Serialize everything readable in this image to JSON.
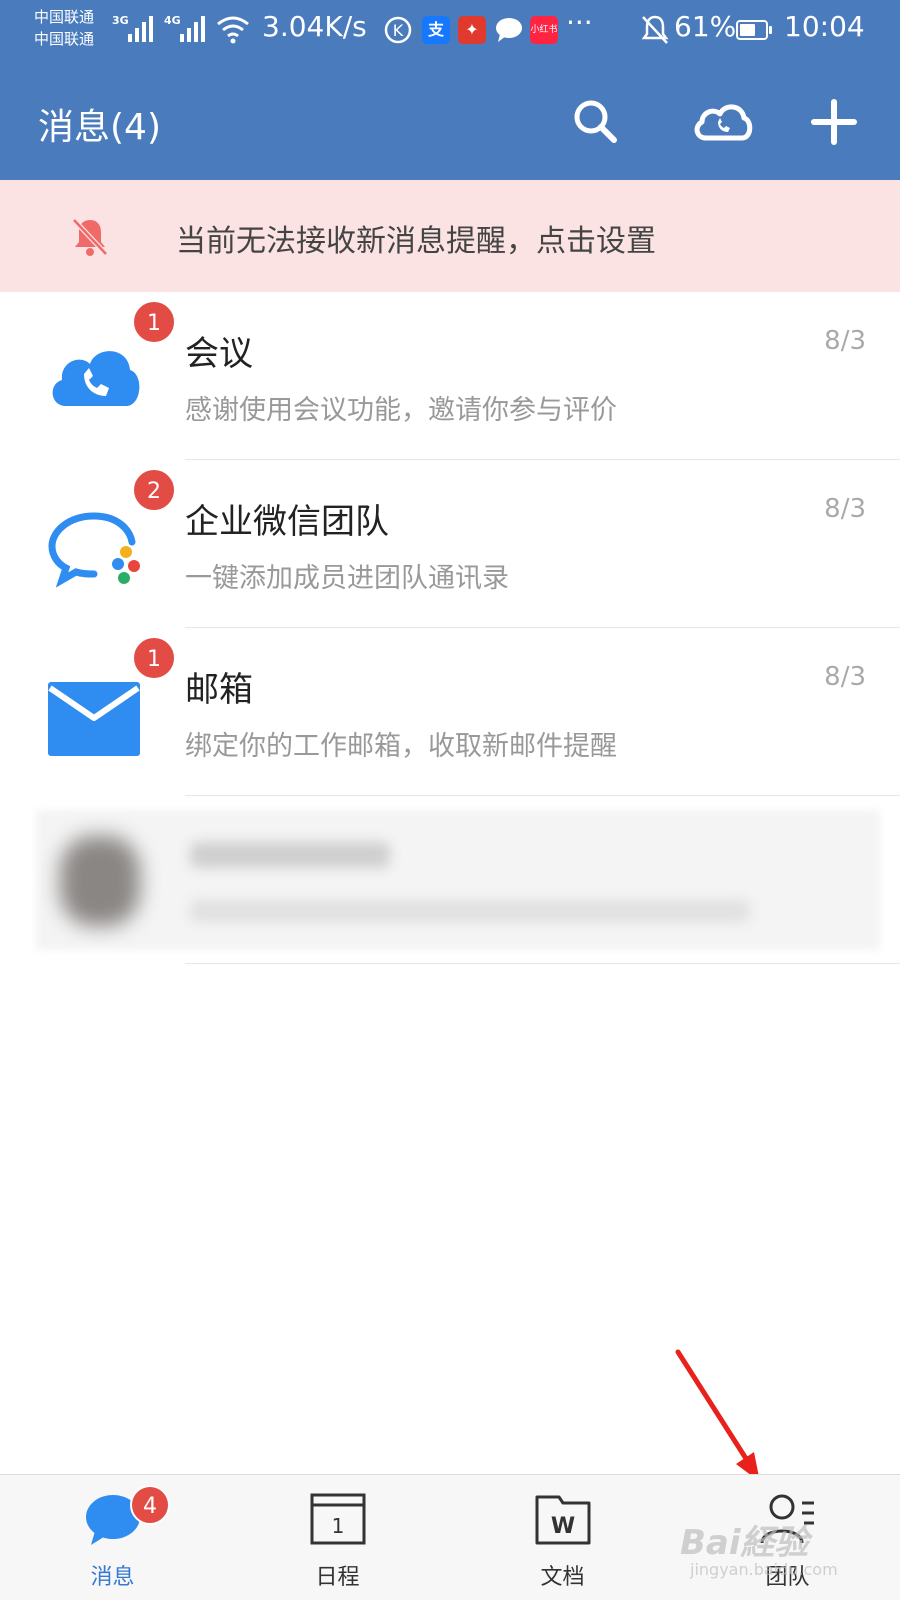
{
  "status_bar": {
    "carrier_1": "中国联通",
    "carrier_2": "中国联通",
    "net_1": "3G",
    "net_2": "4G",
    "speed": "3.04K/s",
    "battery": "61%",
    "battery_level": 0.61,
    "time": "10:04",
    "app_icons": [
      "k-circle-icon",
      "alipay-icon",
      "news-app-icon",
      "chat-bubble-icon",
      "xiaohongshu-icon"
    ],
    "alipay_glyph": "支",
    "xiaohongshu_label": "小红书",
    "more": "···"
  },
  "header": {
    "title": "消息(4)",
    "icons": [
      "search-icon",
      "cloud-phone-icon",
      "plus-icon"
    ]
  },
  "notice": {
    "icon": "bell-muted-icon",
    "text": "当前无法接收新消息提醒，点击设置"
  },
  "messages": [
    {
      "name": "会议",
      "preview": "感谢使用会议功能，邀请你参与评价",
      "date": "8/3",
      "badge": "1",
      "icon": "meeting-cloud-icon"
    },
    {
      "name": "企业微信团队",
      "preview": "一键添加成员进团队通讯录",
      "date": "8/3",
      "badge": "2",
      "icon": "wework-icon"
    },
    {
      "name": "邮箱",
      "preview": "绑定你的工作邮箱，收取新邮件提醒",
      "date": "8/3",
      "badge": "1",
      "icon": "mail-envelope-icon"
    }
  ],
  "tabs": [
    {
      "label": "消息",
      "badge": "4",
      "icon": "message-bubble-icon",
      "active": true
    },
    {
      "label": "日程",
      "icon": "calendar-icon",
      "calendar_day": "1"
    },
    {
      "label": "文档",
      "icon": "document-folder-icon",
      "doc_glyph": "W"
    },
    {
      "label": "团队",
      "icon": "contacts-icon"
    }
  ],
  "colors": {
    "header": "#4a7bbd",
    "notice_bg": "#fbe3e3",
    "badge": "#e34b45",
    "active_tab": "#3578d4"
  }
}
